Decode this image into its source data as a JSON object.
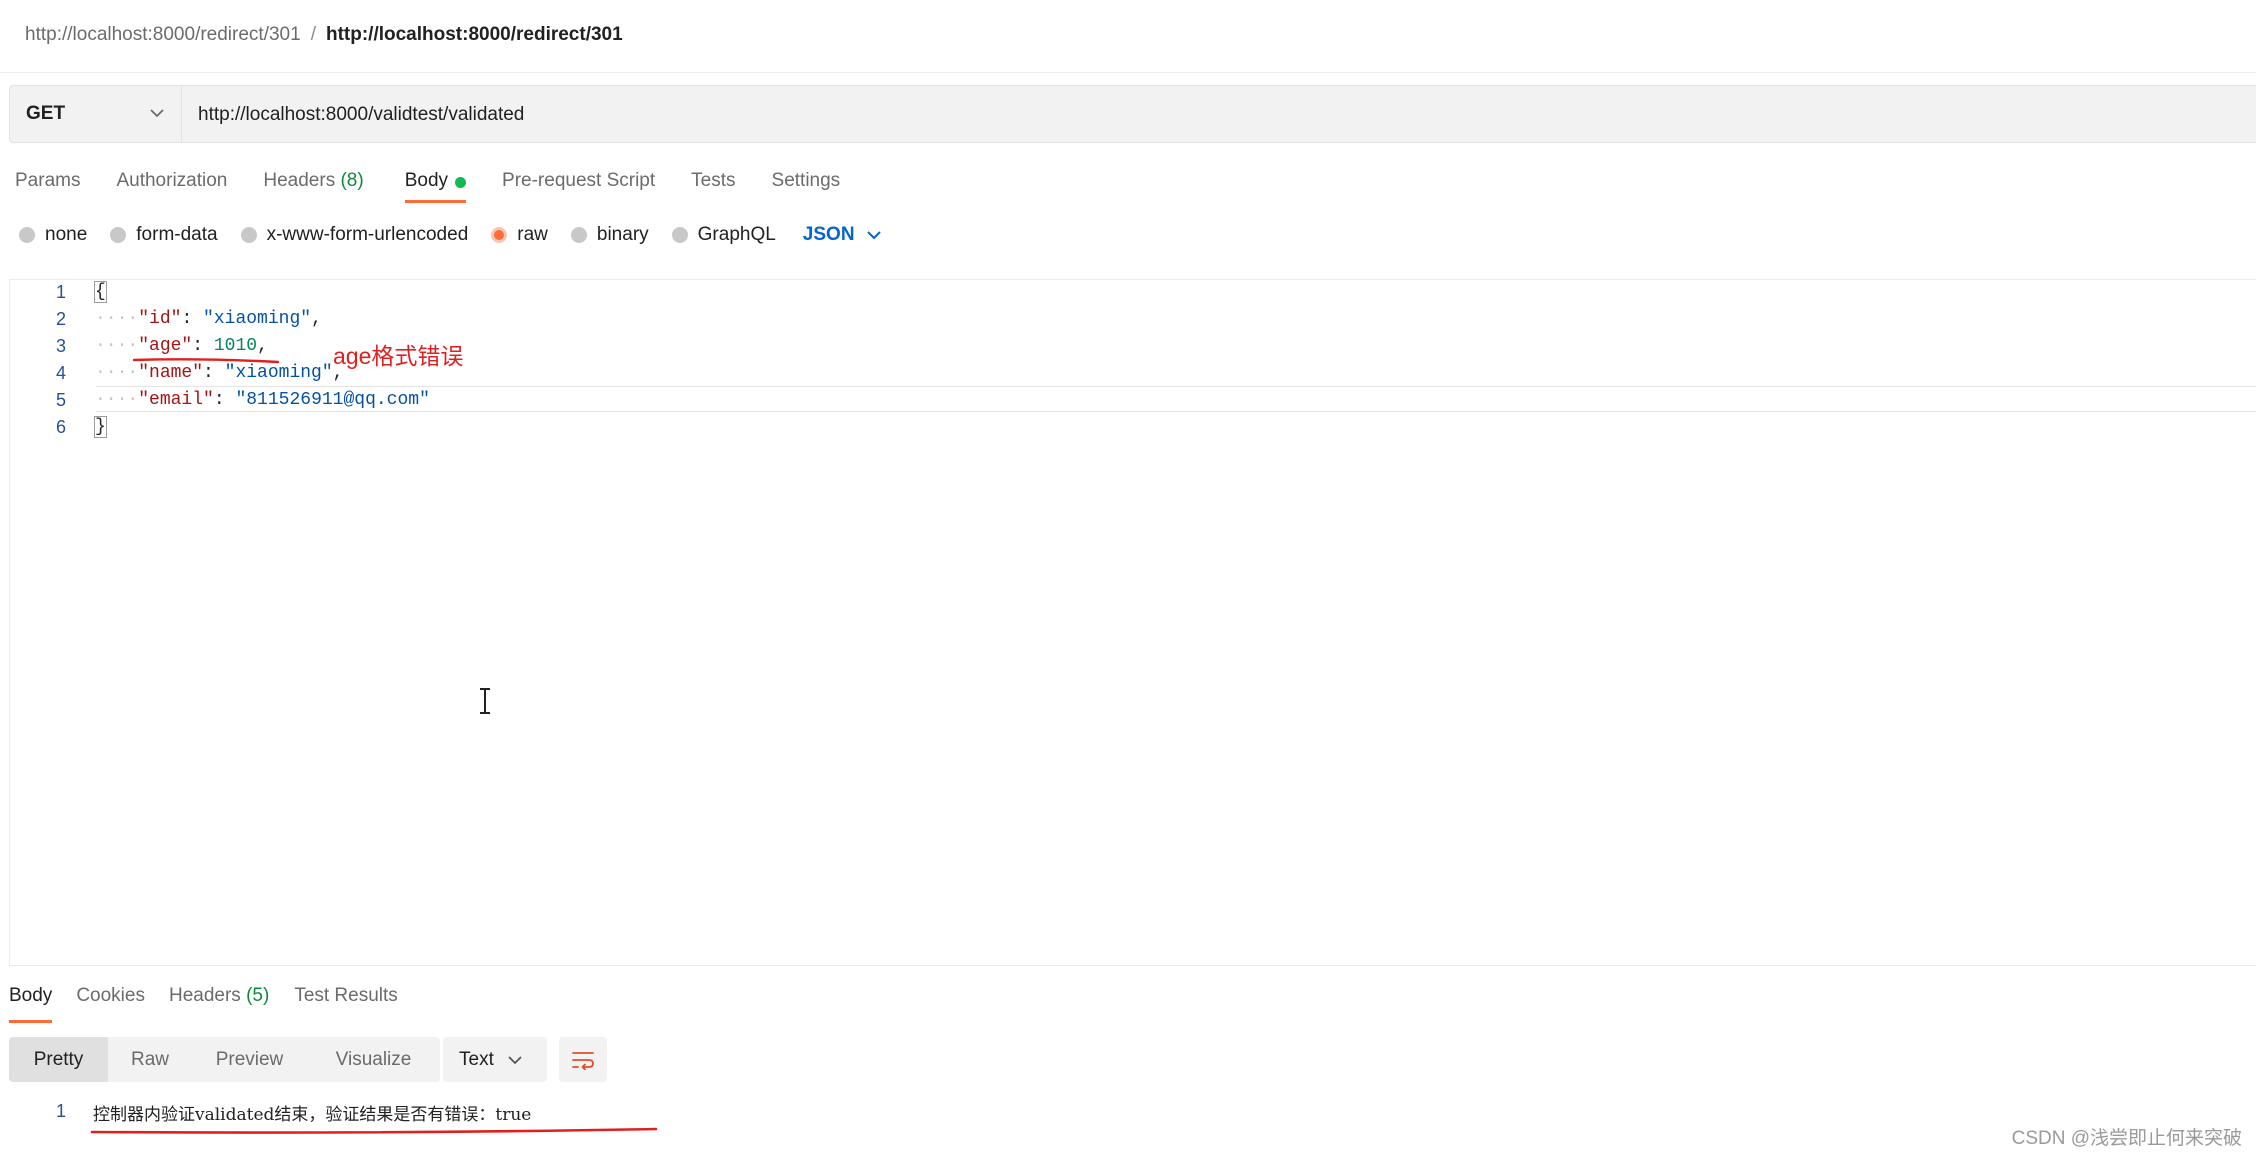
{
  "breadcrumb": {
    "parent": "http://localhost:8000/redirect/301",
    "separator": "/",
    "current": "http://localhost:8000/redirect/301"
  },
  "request": {
    "method": "GET",
    "url": "http://localhost:8000/validtest/validated"
  },
  "request_tabs": [
    {
      "label": "Params"
    },
    {
      "label": "Authorization"
    },
    {
      "label": "Headers",
      "count": "(8)"
    },
    {
      "label": "Body",
      "active": true
    },
    {
      "label": "Pre-request Script"
    },
    {
      "label": "Tests"
    },
    {
      "label": "Settings"
    }
  ],
  "body_types": [
    {
      "label": "none"
    },
    {
      "label": "form-data"
    },
    {
      "label": "x-www-form-urlencoded"
    },
    {
      "label": "raw",
      "selected": true
    },
    {
      "label": "binary"
    },
    {
      "label": "GraphQL"
    }
  ],
  "body_format": "JSON",
  "editor": {
    "line_numbers": [
      "1",
      "2",
      "3",
      "4",
      "5",
      "6"
    ],
    "open_brace": "{",
    "close_brace": "}",
    "fields": [
      {
        "key": "\"id\"",
        "colon": ": ",
        "value": "\"xiaoming\"",
        "comma": ","
      },
      {
        "key": "\"age\"",
        "colon": ": ",
        "value": "1010",
        "comma": ","
      },
      {
        "key": "\"name\"",
        "colon": ": ",
        "value": "\"xiaoming\"",
        "comma": ","
      },
      {
        "key": "\"email\"",
        "colon": ": ",
        "value": "\"811526911@qq.com\"",
        "comma": ""
      }
    ]
  },
  "annotation_text": "age格式错误",
  "response": {
    "tabs": [
      {
        "label": "Body",
        "active": true
      },
      {
        "label": "Cookies"
      },
      {
        "label": "Headers",
        "count": "(5)"
      },
      {
        "label": "Test Results"
      }
    ],
    "view_modes": [
      {
        "label": "Pretty",
        "active": true
      },
      {
        "label": "Raw"
      },
      {
        "label": "Preview"
      },
      {
        "label": "Visualize"
      }
    ],
    "format": "Text",
    "line_number": "1",
    "body_text": "控制器内验证validated结束，验证结果是否有错误：true"
  },
  "watermark": "CSDN @浅尝即止何来突破",
  "colors": {
    "accent": "#ff6c37",
    "annotation": "#e02020",
    "count_green": "#0c8a3a",
    "json_key": "#a31515",
    "json_string": "#0451a5",
    "json_number": "#098658",
    "link_blue": "#0265d2"
  }
}
